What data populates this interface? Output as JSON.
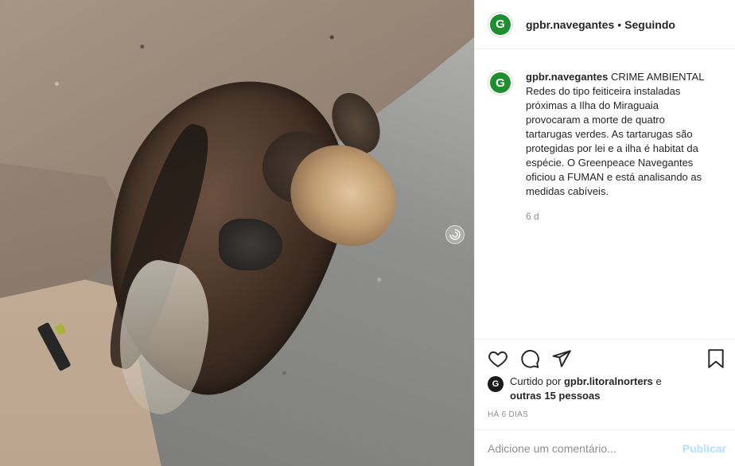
{
  "post": {
    "image_icon": "carousel-indicator-icon"
  },
  "header": {
    "avatar_letter": "G",
    "username": "gpbr.navegantes",
    "separator": "•",
    "follow_label": "Seguindo"
  },
  "caption": {
    "avatar_letter": "G",
    "username": "gpbr.navegantes",
    "text": "CRIME AMBIENTAL Redes do tipo feiticeira instaladas próximas a Ilha do Miraguaia provocaram a morte de quatro tartarugas verdes. As tartarugas são protegidas por lei e a ilha é habitat da espécie. O Greenpeace Navegantes oficiou a FUMAN e está analisando as medidas cabíveis.",
    "time": "6 d"
  },
  "actions": {
    "like_icon": "heart-icon",
    "comment_icon": "comment-icon",
    "share_icon": "share-icon",
    "save_icon": "bookmark-icon"
  },
  "likes": {
    "avatar_letter": "G",
    "prefix": "Curtido por",
    "user": "gpbr.litoralnorters",
    "conjunction": "e",
    "others": "outras 15 pessoas"
  },
  "date": "HÁ 6 DIAS",
  "comment": {
    "placeholder": "Adicione um comentário...",
    "publish_label": "Publicar"
  },
  "colors": {
    "avatar_green": "#1e8e2f",
    "publish_disabled": "#b2dffc",
    "muted": "#8e8e8e"
  }
}
